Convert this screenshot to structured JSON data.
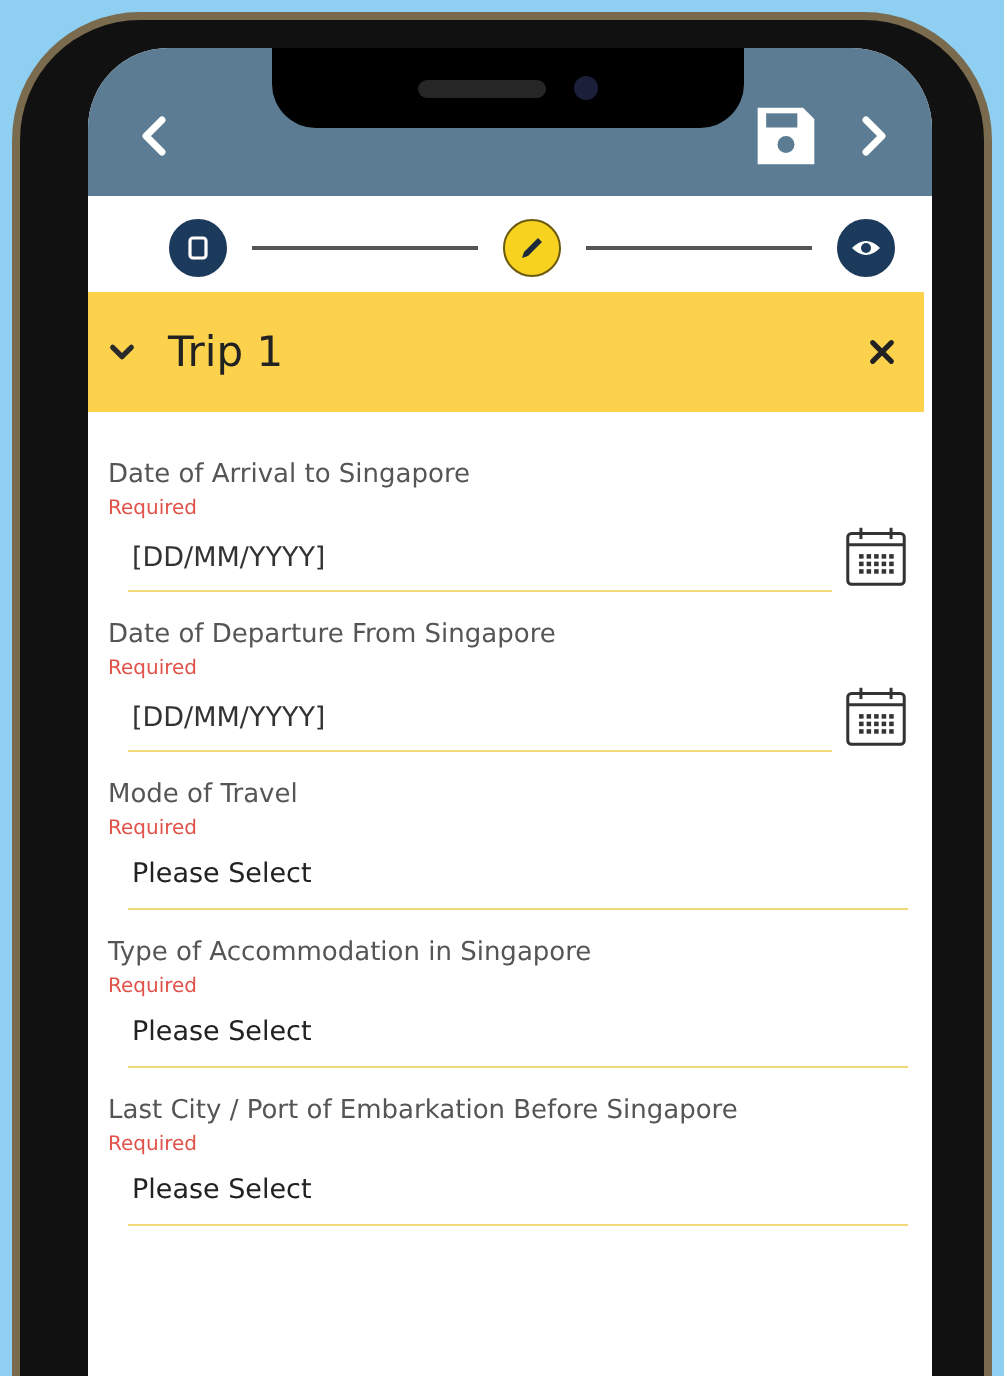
{
  "steps": [
    {
      "kind": "document",
      "selected": false
    },
    {
      "kind": "edit",
      "selected": true
    },
    {
      "kind": "preview",
      "selected": false
    }
  ],
  "section": {
    "title": "Trip 1",
    "expanded": true
  },
  "fields": [
    {
      "kind": "date",
      "label": "Date of Arrival to Singapore",
      "note": "Required",
      "placeholder": "[DD/MM/YYYY]"
    },
    {
      "kind": "date",
      "label": "Date of Departure From Singapore",
      "note": "Required",
      "placeholder": "[DD/MM/YYYY]"
    },
    {
      "kind": "select",
      "label": "Mode of Travel",
      "note": "Required",
      "value": "Please Select"
    },
    {
      "kind": "select",
      "label": "Type of Accommodation in Singapore",
      "note": "Required",
      "value": "Please Select"
    },
    {
      "kind": "select",
      "label": "Last City / Port of Embarkation Before Singapore",
      "note": "Required",
      "value": "Please Select"
    }
  ]
}
